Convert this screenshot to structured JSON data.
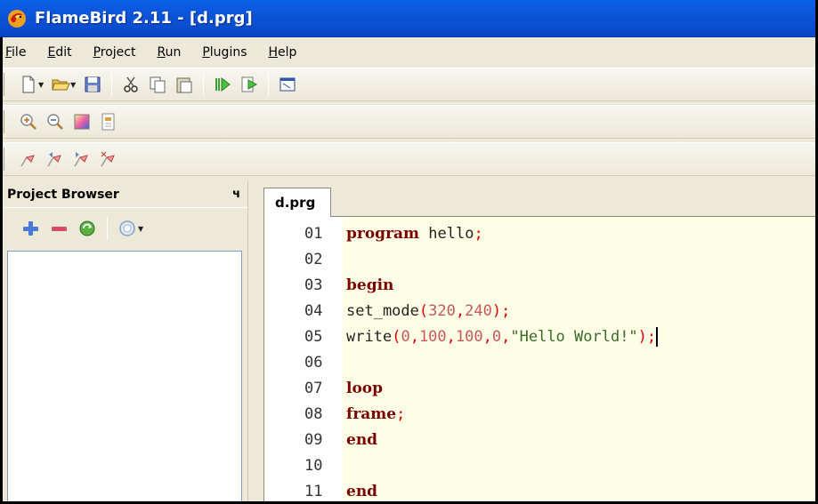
{
  "window": {
    "title": "FlameBird 2.11 - [d.prg]"
  },
  "menu": {
    "items": [
      "File",
      "Edit",
      "Project",
      "Run",
      "Plugins",
      "Help"
    ]
  },
  "toolbar1": [
    "new-file",
    "open-file",
    "save-file",
    "cut",
    "copy",
    "paste",
    "compile",
    "run",
    "window"
  ],
  "project_browser": {
    "title": "Project Browser",
    "pin_label": "ф",
    "tools": [
      "add",
      "remove",
      "refresh",
      "options"
    ]
  },
  "editor": {
    "tab": "d.prg",
    "lines": [
      {
        "num": "01",
        "tokens": [
          [
            "kw",
            "program"
          ],
          [
            "id",
            " hello"
          ],
          [
            "sym",
            ";"
          ]
        ]
      },
      {
        "num": "02",
        "tokens": []
      },
      {
        "num": "03",
        "tokens": [
          [
            "kw",
            "begin"
          ]
        ]
      },
      {
        "num": "04",
        "tokens": [
          [
            "id",
            "set_mode"
          ],
          [
            "sym",
            "("
          ],
          [
            "num",
            "320"
          ],
          [
            "sym",
            ","
          ],
          [
            "num",
            "240"
          ],
          [
            "sym",
            ")"
          ],
          [
            "sym",
            ";"
          ]
        ]
      },
      {
        "num": "05",
        "tokens": [
          [
            "id",
            "write"
          ],
          [
            "sym",
            "("
          ],
          [
            "num",
            "0"
          ],
          [
            "sym",
            ","
          ],
          [
            "num",
            "100"
          ],
          [
            "sym",
            ","
          ],
          [
            "num",
            "100"
          ],
          [
            "sym",
            ","
          ],
          [
            "num",
            "0"
          ],
          [
            "sym",
            ","
          ],
          [
            "str",
            "\"Hello World!\""
          ],
          [
            "sym",
            ")"
          ],
          [
            "sym",
            ";"
          ]
        ]
      },
      {
        "num": "06",
        "tokens": []
      },
      {
        "num": "07",
        "tokens": [
          [
            "kw",
            "loop"
          ]
        ]
      },
      {
        "num": "08",
        "tokens": [
          [
            "kw",
            "frame"
          ],
          [
            "sym",
            ";"
          ]
        ]
      },
      {
        "num": "09",
        "tokens": [
          [
            "kw",
            "end"
          ]
        ]
      },
      {
        "num": "10",
        "tokens": []
      },
      {
        "num": "11",
        "tokens": [
          [
            "kw",
            "end"
          ]
        ]
      }
    ]
  },
  "colors": {
    "titlebar": "#0d54d9",
    "keyword": "#7a0000",
    "number": "#c25a5a",
    "string": "#3a6a2a",
    "editor_bg": "#fefee7"
  }
}
